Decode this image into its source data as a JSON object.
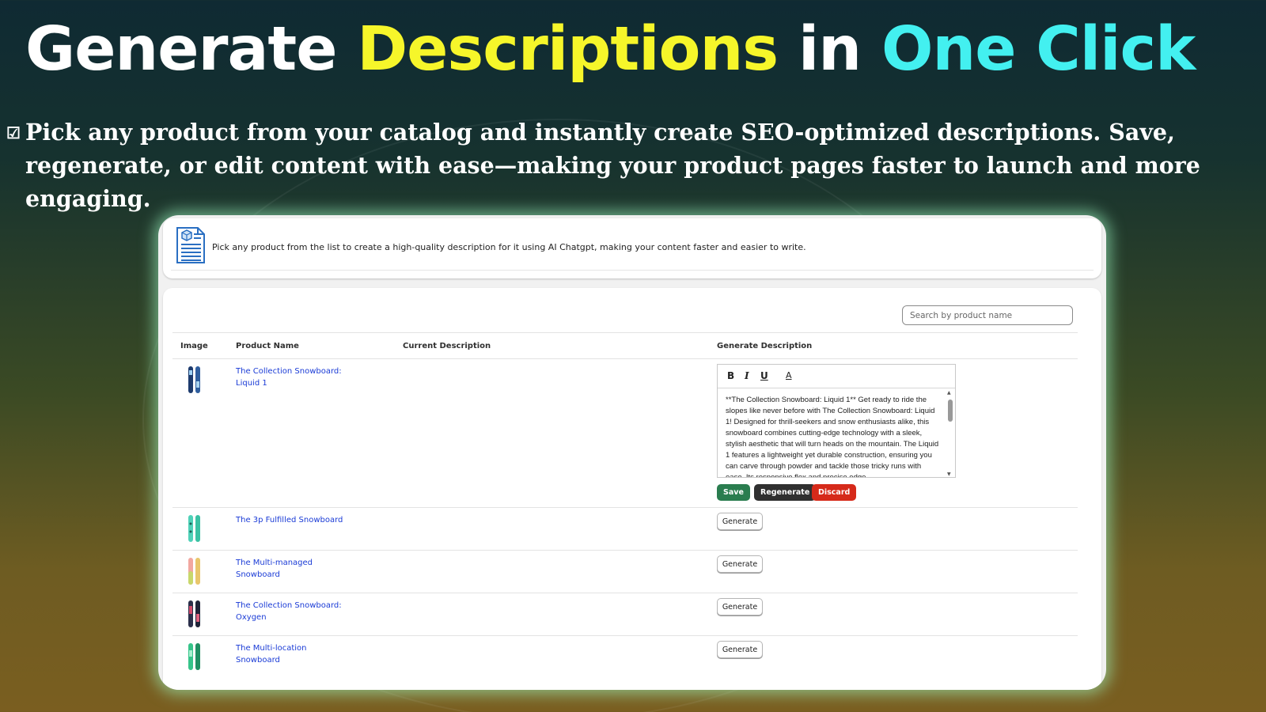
{
  "hero": {
    "title_part1": "Generate ",
    "title_part2": "Descriptions",
    "title_part3": " in ",
    "title_part4": "One Click",
    "subtitle_line1": "Pick any product from your catalog and instantly create SEO-optimized descriptions. Save,",
    "subtitle_line2": "regenerate, or edit content with ease—making your product pages faster to launch and more engaging.",
    "colors": {
      "white": "#ffffff",
      "yellow": "#f6f62a",
      "cyan": "#43f0f0"
    }
  },
  "app": {
    "info_text": "Pick any product from the list to create a high-quality description for it using AI Chatgpt, making your content faster and easier to write.",
    "search_placeholder": "Search by product name",
    "columns": {
      "image": "Image",
      "product_name": "Product Name",
      "current_description": "Current Description",
      "generate_description": "Generate Description"
    },
    "editor": {
      "bold": "B",
      "italic": "I",
      "underline": "U",
      "text_color": "A",
      "content": "**The Collection Snowboard: Liquid 1** Get ready to ride the slopes like never before with The Collection Snowboard: Liquid 1! Designed for thrill-seekers and snow enthusiasts alike, this snowboard combines cutting-edge technology with a sleek, stylish aesthetic that will turn heads on the mountain. The Liquid 1 features a lightweight yet durable construction, ensuring you can carve through powder and tackle those tricky runs with ease. Its responsive flex and precise edge"
    },
    "actions": {
      "save": "Save",
      "regenerate": "Regenerate",
      "discard": "Discard"
    },
    "generate_label": "Generate",
    "products": [
      {
        "name_line1": "The Collection Snowboard:",
        "name_line2": "Liquid 1"
      },
      {
        "name_line1": "The 3p Fulfilled Snowboard",
        "name_line2": ""
      },
      {
        "name_line1": "The Multi-managed",
        "name_line2": "Snowboard"
      },
      {
        "name_line1": "The Collection Snowboard:",
        "name_line2": "Oxygen"
      },
      {
        "name_line1": "The Multi-location",
        "name_line2": "Snowboard"
      }
    ]
  }
}
